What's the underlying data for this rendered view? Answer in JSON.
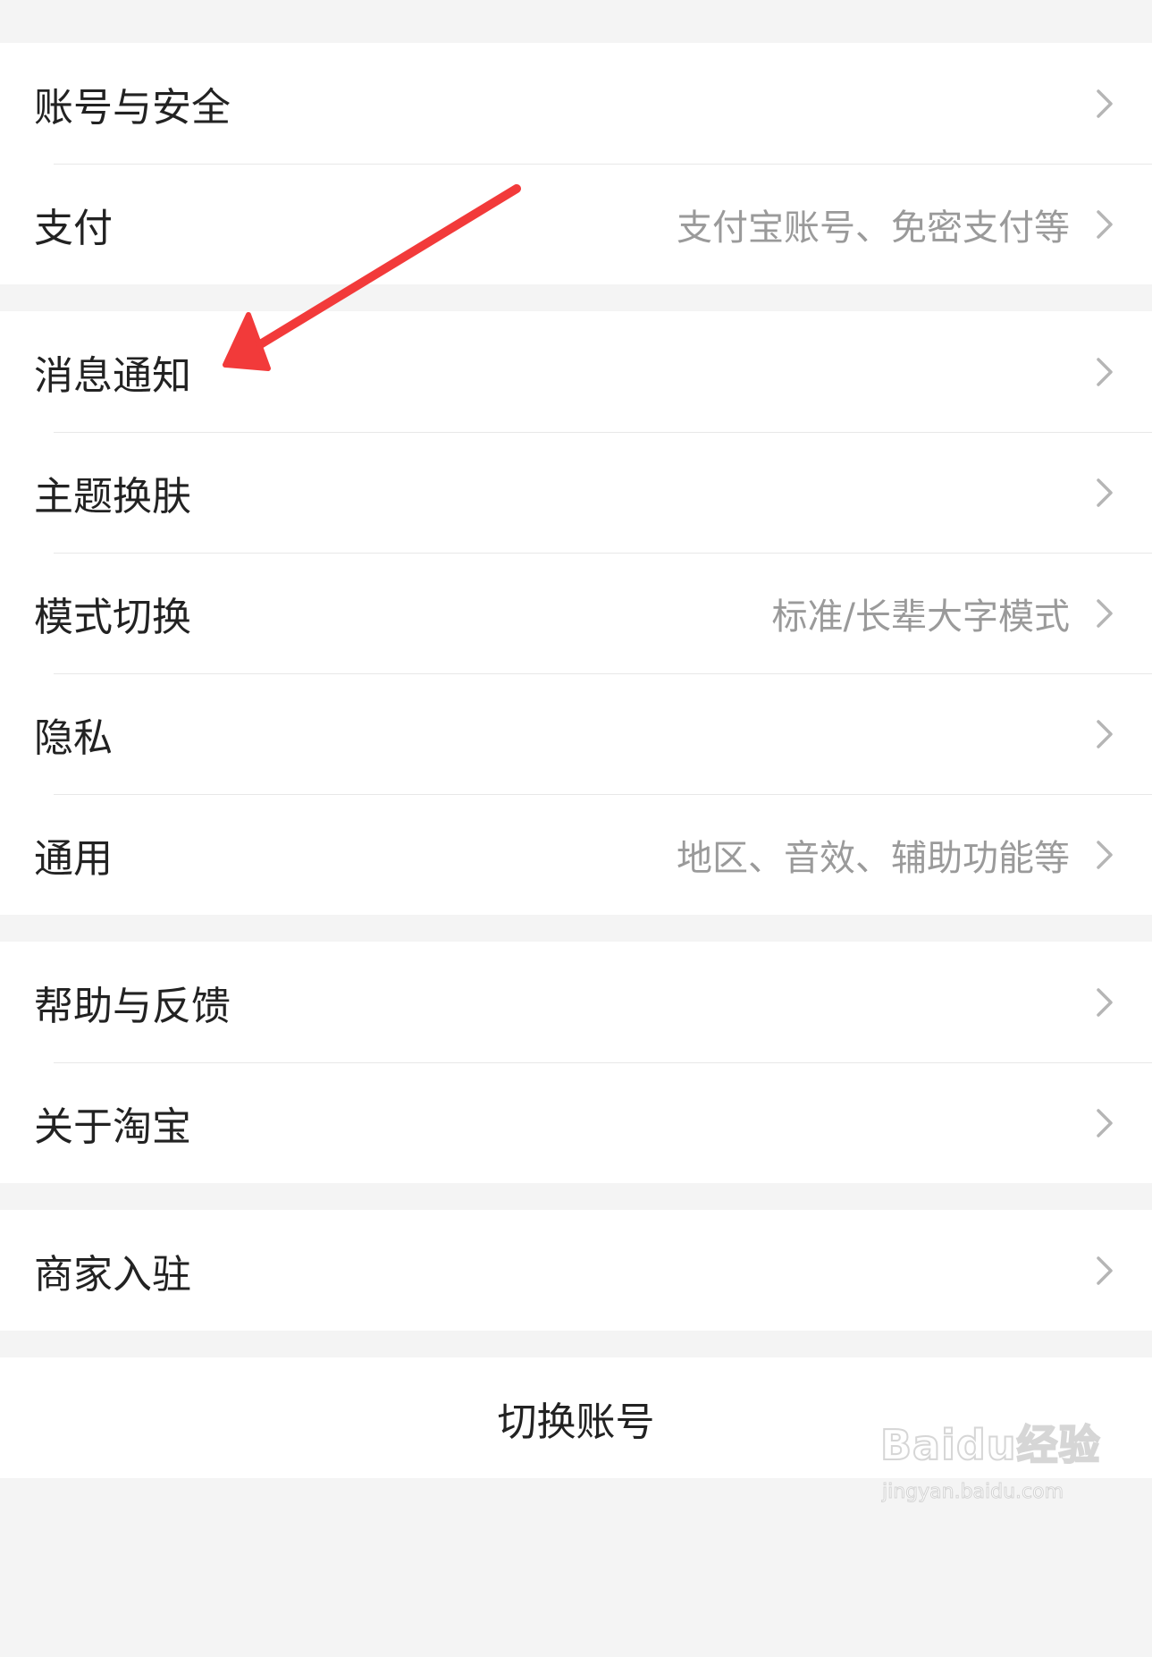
{
  "groups": [
    {
      "items": [
        {
          "label": "账号与安全",
          "hint": ""
        },
        {
          "label": "支付",
          "hint": "支付宝账号、免密支付等"
        }
      ]
    },
    {
      "items": [
        {
          "label": "消息通知",
          "hint": ""
        },
        {
          "label": "主题换肤",
          "hint": ""
        },
        {
          "label": "模式切换",
          "hint": "标准/长辈大字模式"
        },
        {
          "label": "隐私",
          "hint": ""
        },
        {
          "label": "通用",
          "hint": "地区、音效、辅助功能等"
        }
      ]
    },
    {
      "items": [
        {
          "label": "帮助与反馈",
          "hint": ""
        },
        {
          "label": "关于淘宝",
          "hint": ""
        }
      ]
    },
    {
      "items": [
        {
          "label": "商家入驻",
          "hint": ""
        }
      ]
    }
  ],
  "switch_account": {
    "label": "切换账号"
  },
  "watermark": {
    "brand": "Baidu经验",
    "url": "jingyan.baidu.com"
  },
  "colors": {
    "background": "#f4f4f4",
    "row_bg": "#ffffff",
    "label_text": "#222222",
    "hint_text": "#9a9a9a",
    "chevron": "#b5b5b5",
    "annotation_arrow": "#f23a3a"
  },
  "icons": {
    "chevron": "chevron-right-icon",
    "annotation": "red-arrow-annotation"
  }
}
